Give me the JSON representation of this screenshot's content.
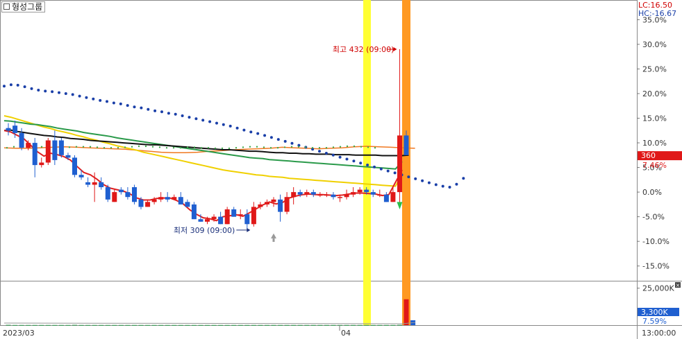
{
  "chart_data": {
    "type": "candlestick",
    "title": "형성그룹",
    "overlay": {
      "lc": "LC:16.50",
      "hc": "HC:-16.67"
    },
    "price_ticks": [
      "35.0%",
      "30.0%",
      "25.0%",
      "20.0%",
      "15.0%",
      "10.0%",
      "5.0%",
      "0.0%",
      "-5.0%",
      "-10.0%",
      "-15.0%"
    ],
    "ylim": [
      -18,
      39
    ],
    "current": {
      "price": "360",
      "change": "7.46%",
      "value": 7.46
    },
    "high_note": {
      "text": "최고 432 (09:00)",
      "value": 29.0
    },
    "low_note": {
      "text": "최저 309 (09:00)",
      "value": -7.7
    },
    "volume": {
      "tick": "25,000K",
      "current": "3,300K",
      "change": "7.59%"
    },
    "x_labels": {
      "left": "2023/03",
      "mid": "04",
      "right": "13:00:00"
    },
    "candles": [
      [
        13,
        14,
        11.5,
        12.5
      ],
      [
        13.5,
        14.5,
        11,
        12
      ],
      [
        12,
        13,
        8.5,
        9
      ],
      [
        9,
        10.5,
        8.5,
        10
      ],
      [
        10,
        11,
        3,
        5.5
      ],
      [
        5.5,
        7,
        5,
        6
      ],
      [
        6,
        11,
        5.5,
        10.5
      ],
      [
        10.5,
        12.5,
        5.5,
        6.5
      ],
      [
        10.5,
        11,
        7,
        7.5
      ],
      [
        7.5,
        8,
        6.5,
        7
      ],
      [
        7,
        7.5,
        3,
        3.5
      ],
      [
        3.5,
        4.5,
        2.5,
        3
      ],
      [
        2,
        3,
        1,
        1.5
      ],
      [
        1.5,
        4,
        -2,
        2
      ],
      [
        2,
        3,
        0.5,
        1
      ],
      [
        1,
        1.5,
        -2,
        -1.5
      ],
      [
        -2,
        0.5,
        -2,
        0
      ],
      [
        0.5,
        1,
        -0.5,
        0
      ],
      [
        0,
        1,
        -1.5,
        -1
      ],
      [
        1,
        1.5,
        -2.5,
        -2
      ],
      [
        -1.5,
        -1,
        -3.5,
        -3
      ],
      [
        -3,
        -1.5,
        -3,
        -2
      ],
      [
        -2,
        -1,
        -2.5,
        -1.5
      ],
      [
        -1.5,
        0,
        -2,
        -1
      ],
      [
        -1,
        0,
        -2,
        -1.5
      ],
      [
        -1.5,
        -0.5,
        -1.5,
        -1
      ],
      [
        -1,
        0,
        -2.5,
        -2.5
      ],
      [
        -2,
        -1.5,
        -3,
        -3
      ],
      [
        -2.5,
        -2,
        -5.5,
        -5.5
      ],
      [
        -5.5,
        -4.5,
        -6,
        -6
      ],
      [
        -6,
        -5,
        -6.5,
        -5.5
      ],
      [
        -5.5,
        -4.5,
        -6,
        -5
      ],
      [
        -5,
        -4,
        -6.5,
        -6.5
      ],
      [
        -6.5,
        -3,
        -6.5,
        -3.5
      ],
      [
        -3.5,
        -3,
        -5,
        -5
      ],
      [
        -4.5,
        -3.5,
        -5.5,
        -4.5
      ],
      [
        -4.5,
        -3.5,
        -7.5,
        -6.5
      ],
      [
        -6.5,
        -2,
        -7,
        -3
      ],
      [
        -3,
        -2,
        -3.5,
        -2.5
      ],
      [
        -2.5,
        -1.5,
        -3,
        -2
      ],
      [
        -2,
        -1,
        -3,
        -1.5
      ],
      [
        -1.5,
        -0.5,
        -6,
        -4
      ],
      [
        -4,
        0,
        -4.5,
        -1
      ],
      [
        -1,
        1,
        -2.5,
        0
      ],
      [
        0,
        0.5,
        -1,
        -0.5
      ],
      [
        -0.5,
        0.5,
        -1,
        0
      ],
      [
        0,
        0.5,
        -1,
        -0.5
      ],
      [
        -0.5,
        0,
        -1,
        -0.5
      ],
      [
        -0.5,
        0,
        -1,
        -0.5
      ],
      [
        -0.5,
        0,
        -1.5,
        -1
      ],
      [
        -1,
        -0.5,
        -2,
        -1
      ],
      [
        -1,
        0.5,
        -1.5,
        -0.5
      ],
      [
        -0.5,
        1,
        -1,
        0
      ],
      [
        0,
        1,
        -0.5,
        0.5
      ],
      [
        0.5,
        1,
        -0.5,
        0
      ],
      [
        0,
        0.5,
        -1,
        -0.5
      ],
      [
        -0.5,
        0.5,
        -1,
        -0.5
      ],
      [
        -0.5,
        0,
        -2,
        -2
      ],
      [
        -2,
        1,
        -2,
        0
      ],
      [
        0,
        29,
        -2.5,
        11.5
      ],
      [
        11.5,
        12.5,
        7.5,
        7.5
      ]
    ],
    "series": [
      {
        "values": [
          21.5,
          21.8,
          21.7,
          21.4,
          21.0,
          20.7,
          20.5,
          20.4,
          20.2,
          20.0,
          19.8,
          19.5,
          19.2,
          18.9,
          18.6,
          18.4,
          18.1,
          17.9,
          17.6,
          17.3,
          17.1,
          16.8,
          16.5,
          16.3,
          16.0,
          15.8,
          15.5,
          15.2,
          14.9,
          14.6,
          14.3,
          14.0,
          13.7,
          13.4,
          13.0,
          12.6,
          12.2,
          11.9,
          11.5,
          11.1,
          10.7,
          10.3,
          9.9,
          9.5,
          9.1,
          8.7,
          8.3,
          7.9,
          7.5,
          7.1,
          6.7,
          6.3,
          5.9,
          5.5,
          5.1,
          4.7,
          4.3,
          3.9,
          3.5,
          3.1,
          2.7,
          2.3,
          1.9,
          1.5,
          1.2,
          1.0,
          1.6,
          2.8
        ]
      },
      {
        "values": [
          12.5,
          12.6,
          12.3,
          12.1,
          11.9,
          11.7,
          11.5,
          11.4,
          11.2,
          11.1,
          10.9,
          10.8,
          10.7,
          10.5,
          10.4,
          10.3,
          10.2,
          10.1,
          10.0,
          9.9,
          9.8,
          9.7,
          9.6,
          9.6,
          9.5,
          9.4,
          9.3,
          9.2,
          9.1,
          9.0,
          8.9,
          8.8,
          8.7,
          8.6,
          8.6,
          8.5,
          8.4,
          8.3,
          8.3,
          8.2,
          8.1,
          8.0,
          8.0,
          7.9,
          7.9,
          7.8,
          7.8,
          7.7,
          7.7,
          7.7,
          7.6,
          7.6,
          7.6,
          7.5,
          7.5,
          7.5,
          7.5,
          7.4,
          7.4,
          7.4,
          7.4,
          7.5
        ]
      },
      {
        "values": [
          14.5,
          14.4,
          14.2,
          14.0,
          13.8,
          13.7,
          13.5,
          13.3,
          13.0,
          12.8,
          12.6,
          12.4,
          12.1,
          11.9,
          11.7,
          11.5,
          11.3,
          11.0,
          10.8,
          10.6,
          10.4,
          10.2,
          10.0,
          9.8,
          9.6,
          9.4,
          9.2,
          9.0,
          8.8,
          8.6,
          8.4,
          8.2,
          8.0,
          7.8,
          7.6,
          7.4,
          7.2,
          7.0,
          6.9,
          6.8,
          6.6,
          6.5,
          6.4,
          6.3,
          6.2,
          6.1,
          6.0,
          5.9,
          5.8,
          5.7,
          5.6,
          5.5,
          5.4,
          5.3,
          5.2,
          5.1,
          5.0,
          4.9,
          4.8,
          4.7,
          6.2
        ]
      },
      {
        "values": [
          15.5,
          15.2,
          14.8,
          14.4,
          14.0,
          13.6,
          13.2,
          12.9,
          12.5,
          12.2,
          11.9,
          11.5,
          11.2,
          10.8,
          10.5,
          10.1,
          9.8,
          9.4,
          9.1,
          8.8,
          8.5,
          8.1,
          7.8,
          7.5,
          7.2,
          6.9,
          6.6,
          6.3,
          6.0,
          5.7,
          5.4,
          5.1,
          4.8,
          4.5,
          4.3,
          4.1,
          3.9,
          3.7,
          3.5,
          3.4,
          3.2,
          3.1,
          3.0,
          2.8,
          2.7,
          2.6,
          2.5,
          2.4,
          2.3,
          2.2,
          2.1,
          2.0,
          1.9,
          1.8,
          1.7,
          1.6,
          1.5,
          1.4,
          1.3,
          1.2,
          3.8
        ]
      },
      {
        "values": [
          12.5,
          12.0,
          11.4,
          10.8,
          10.2,
          9.5,
          8.8,
          8.1,
          7.5,
          6.9,
          6.3,
          5.7,
          5.1,
          4.5,
          4.0,
          3.5,
          3.0,
          2.6,
          2.2,
          1.8,
          1.4,
          1.0,
          0.7,
          0.4,
          0.1,
          -0.2,
          -0.5,
          -0.8,
          -1.1,
          -1.4,
          -1.7,
          -2.0,
          -2.2,
          -2.4,
          -2.6,
          -2.8,
          -3.0,
          -3.1,
          -3.0,
          -2.8,
          -2.6,
          -2.4,
          -2.2,
          -1.9,
          -1.6,
          -1.3,
          -1.0,
          -0.7,
          -0.5,
          -0.3,
          -0.2,
          -0.1,
          0,
          0.1,
          0.2,
          0.2,
          0.3,
          0.3,
          0.4,
          0.5,
          0.5,
          0.6,
          0.8,
          1.1,
          1.4,
          1.8,
          2.3,
          2.8,
          3.3,
          3.8,
          4.2,
          4.6,
          4.9,
          5.2,
          5.5,
          5.7,
          5.9,
          6.0,
          6.1,
          6.1,
          6.0,
          5.8,
          5.6,
          5.3,
          5.0,
          4.6,
          4.2,
          3.8,
          3.4,
          3.0,
          2.6,
          2.2,
          1.8,
          1.4,
          1.0,
          0.7,
          0.4,
          0.2,
          0,
          -0.1,
          -0.2,
          -0.3,
          -0.3,
          -0.3,
          -0.2,
          -0.1,
          0,
          0.1,
          0.2,
          0.3,
          0.4,
          0.5,
          0.6,
          0.7,
          0.8,
          0.9,
          1.0,
          1.2,
          1.4
        ]
      },
      {
        "values": [
          12.5,
          12.2,
          11.5,
          10.8,
          9.5,
          8.2,
          7.3,
          7.9,
          7.6,
          7.2,
          6.5,
          5.2,
          4.0,
          3.5,
          2.6,
          1.5,
          0.8,
          0.5,
          0.2,
          -0.4,
          -1.2,
          -1.6,
          -1.6,
          -1.3,
          -1.2,
          -1.2,
          -1.7,
          -2.4,
          -3.6,
          -4.5,
          -5.2,
          -5.4,
          -5.8,
          -5.0,
          -4.8,
          -4.6,
          -4.9,
          -4.2,
          -3.4,
          -2.6,
          -2.0,
          -2.4,
          -2.1,
          -1.2,
          -0.8,
          -0.5,
          -0.4,
          -0.5,
          -0.5,
          -0.6,
          -0.7,
          -0.6,
          -0.4,
          -0.2,
          -0.2,
          -0.3,
          -0.4,
          -0.7,
          -0.5,
          2.0,
          4.5
        ]
      },
      {
        "values": [
          9.0,
          8.9,
          8.9,
          9.0,
          9.1,
          9.2,
          9.1,
          9.0,
          8.9,
          8.8,
          8.7,
          8.5,
          8.3,
          8.1,
          8.0,
          8.0,
          8.1,
          8.3,
          8.4,
          8.6,
          8.7,
          8.8,
          8.9,
          9.1,
          9.0,
          8.9,
          8.8,
          8.9,
          9.0,
          9.2,
          9.3,
          9.2,
          9.1,
          9.0,
          8.9
        ]
      },
      {
        "values": [
          0.2,
          0.1,
          0.1,
          0.1,
          0.1,
          0.1,
          0.1,
          0.1,
          0.1,
          0.1,
          0.2,
          0.1,
          0.1,
          0.1,
          0.1,
          0.1,
          0.1,
          0.1,
          0.1,
          0.1,
          0.1,
          0.1,
          0.1,
          0.1,
          0.1,
          0.1,
          0.1,
          0.1,
          0.1,
          0.1,
          0.1,
          0.1,
          0.1,
          0.1,
          0.1,
          0.1,
          0.1,
          0.1,
          0.1,
          0.1,
          0.1,
          0.1,
          0.1,
          0.1,
          0.1,
          0.1,
          0.1,
          0.1,
          0.1,
          0.1,
          0.1,
          0.1,
          0.1,
          0.1,
          0.1,
          0.1,
          0.1,
          0.1,
          0.1,
          0.2,
          17.5,
          3.3
        ]
      }
    ]
  }
}
